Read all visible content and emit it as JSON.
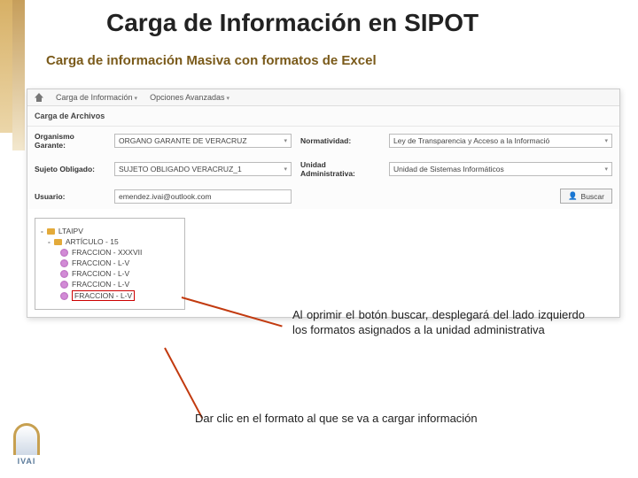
{
  "title": "Carga de Información en SIPOT",
  "subtitle": "Carga de información Masiva con formatos de Excel",
  "menu": {
    "item1": "Carga de Información",
    "item2": "Opciones Avanzadas"
  },
  "section_header": "Carga de Archivos",
  "form": {
    "label_organismo": "Organismo Garante:",
    "value_organismo": "ORGANO GARANTE DE VERACRUZ",
    "label_normatividad": "Normatividad:",
    "value_normatividad": "Ley de Transparencia y Acceso a la Informació",
    "label_sujeto": "Sujeto Obligado:",
    "value_sujeto": "SUJETO OBLIGADO VERACRUZ_1",
    "label_unidad": "Unidad Administrativa:",
    "value_unidad": "Unidad de Sistemas Informáticos",
    "label_usuario": "Usuario:",
    "value_usuario": "emendez.ivai@outlook.com",
    "search_label": "Buscar"
  },
  "tree": {
    "root": "LTAIPV",
    "art": "ARTÍCULO - 15",
    "f1": "FRACCION - XXXVII",
    "f2": "FRACCION - L-V",
    "f3": "FRACCION - L-V",
    "f4": "FRACCION - L-V",
    "f5": "FRACCION - L-V"
  },
  "callout1": "Al oprimir el botón buscar, desplegará del lado izquierdo los formatos asignados a la unidad administrativa",
  "callout2": "Dar clic en el formato al que se va a cargar información",
  "logo_text": "IVAI"
}
